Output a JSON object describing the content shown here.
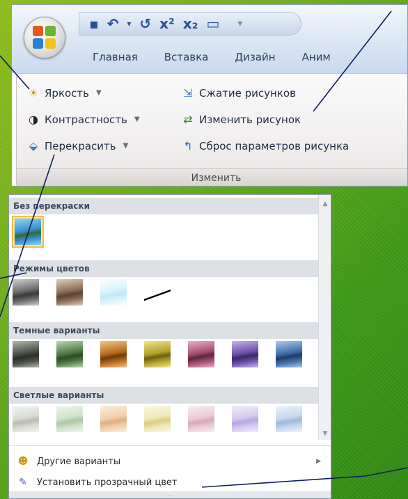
{
  "quick_access": {
    "items": [
      {
        "name": "save",
        "glyph": "▪"
      },
      {
        "name": "undo",
        "glyph": "↶"
      },
      {
        "name": "dropdown",
        "glyph": "▾"
      },
      {
        "name": "redo",
        "glyph": "↺"
      },
      {
        "name": "superscript",
        "glyph": "x²"
      },
      {
        "name": "subscript",
        "glyph": "x₂"
      },
      {
        "name": "new",
        "glyph": "▭"
      }
    ],
    "customize_glyph": "▾"
  },
  "tabs": [
    "Главная",
    "Вставка",
    "Дизайн",
    "Аним"
  ],
  "group": {
    "label": "Изменить",
    "left_commands": [
      {
        "label": "Яркость",
        "icon": "sun-icon",
        "glyph": "☀"
      },
      {
        "label": "Контрастность",
        "icon": "contrast-icon",
        "glyph": "◑"
      },
      {
        "label": "Перекрасить",
        "icon": "recolor-icon",
        "glyph": "⬙"
      }
    ],
    "right_commands": [
      {
        "label": "Сжатие рисунков",
        "icon": "compress-icon",
        "glyph": "⇲"
      },
      {
        "label": "Изменить рисунок",
        "icon": "change-picture-icon",
        "glyph": "⇄"
      },
      {
        "label": "Сброс параметров рисунка",
        "icon": "reset-picture-icon",
        "glyph": "↰"
      }
    ]
  },
  "dropdown": {
    "sections": [
      {
        "title": "Без перекраски",
        "tiles": [
          "original"
        ]
      },
      {
        "title": "Режимы цветов",
        "tiles": [
          "grayscale",
          "sepia",
          "washout",
          "black-white"
        ]
      },
      {
        "title": "Темные варианты",
        "tiles": [
          "dark-gray",
          "dark-green",
          "dark-orange",
          "dark-yellow",
          "dark-pink",
          "dark-purple",
          "dark-blue"
        ]
      },
      {
        "title": "Светлые варианты",
        "tiles": [
          "light-gray",
          "light-green",
          "light-orange",
          "light-yellow",
          "light-pink",
          "light-purple",
          "light-blue"
        ]
      }
    ],
    "menu": [
      {
        "label": "Другие варианты",
        "icon": "more-colors-icon",
        "glyph": "☻",
        "has_submenu": true
      },
      {
        "label": "Установить прозрачный цвет",
        "icon": "transparent-color-icon",
        "glyph": "✎",
        "has_submenu": false
      }
    ],
    "grip_glyph": "....."
  },
  "colors": {
    "original": [
      "#3a8fd0",
      "#8fd6ef",
      "#2e6c34"
    ],
    "grayscale": [
      "#6a6a6a",
      "#cfcfcf",
      "#3a3a3a"
    ],
    "sepia": [
      "#8a6e56",
      "#e2cfb9",
      "#5a4332"
    ],
    "washout": [
      "#d6f2fb",
      "#ffffff",
      "#bfe8f4"
    ],
    "black-white": [
      "#ffffff",
      "#ffffff",
      "#000000"
    ],
    "dark-gray": [
      "#4b5048",
      "#b3b6ab",
      "#2c2f29"
    ],
    "dark-green": [
      "#4f7a45",
      "#b8d8ae",
      "#2e4a28"
    ],
    "dark-orange": [
      "#b96a1f",
      "#f2c586",
      "#6e3b0d"
    ],
    "dark-yellow": [
      "#b3a12a",
      "#f0e68c",
      "#6b5f12"
    ],
    "dark-pink": [
      "#a24d6e",
      "#eab0c5",
      "#5e2540"
    ],
    "dark-purple": [
      "#6b4fa8",
      "#c6b4ee",
      "#3a2968"
    ],
    "dark-blue": [
      "#3f6fa6",
      "#aac8ee",
      "#1f3c63"
    ],
    "light-gray": [
      "#d8dbd4",
      "#f4f5f2",
      "#b9bcb4"
    ],
    "light-green": [
      "#cfe1c8",
      "#f1f7ee",
      "#adc7a3"
    ],
    "light-orange": [
      "#f1cfa8",
      "#fbefe0",
      "#ddb083"
    ],
    "light-yellow": [
      "#efe7b4",
      "#fbf8e4",
      "#d9cd87"
    ],
    "light-pink": [
      "#ebcad6",
      "#f9eef2",
      "#d6a9ba"
    ],
    "light-purple": [
      "#d4c9ee",
      "#f2eefb",
      "#b6a6de"
    ],
    "light-blue": [
      "#c6d7ee",
      "#eef4fb",
      "#9fb9de"
    ],
    "accent_selected": "#f0c040",
    "callout_line": "#0f1f5a"
  }
}
